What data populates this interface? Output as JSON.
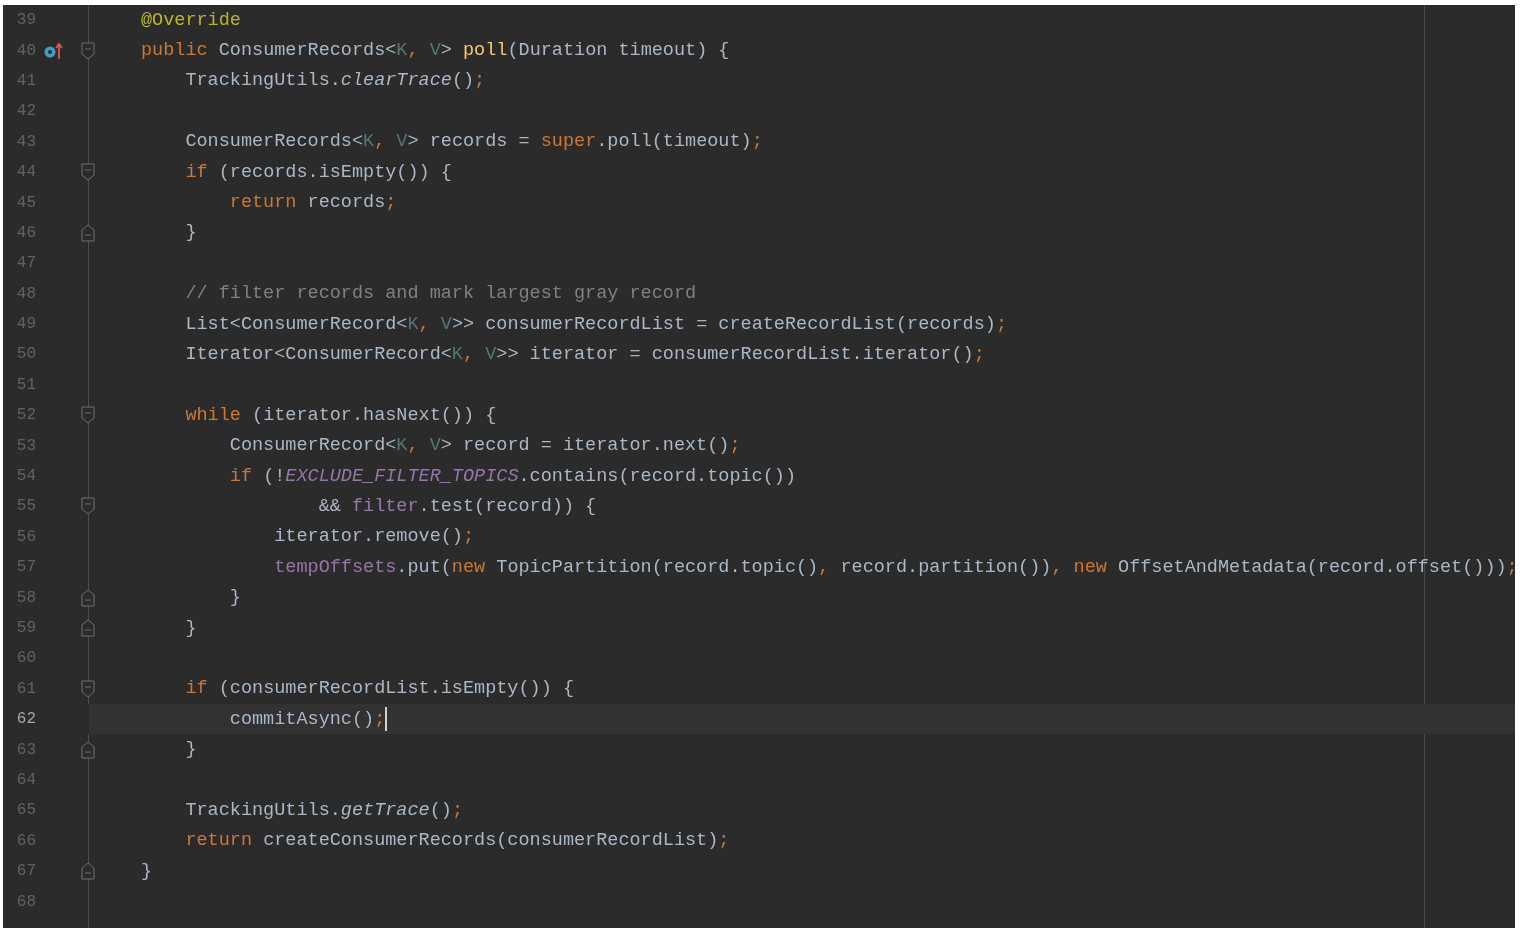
{
  "editor": {
    "lines": [
      {
        "number": "39",
        "current": false,
        "override_marker": false,
        "fold_start": false,
        "fold_end": false,
        "tokens": [
          {
            "kind": "annotation",
            "text": "@Override"
          }
        ]
      },
      {
        "number": "40",
        "current": false,
        "override_marker": true,
        "fold_start": true,
        "fold_end": false,
        "tokens": [
          {
            "kind": "keyword",
            "text": "public"
          },
          {
            "kind": "plain",
            "text": " ConsumerRecords<"
          },
          {
            "kind": "type-param",
            "text": "K"
          },
          {
            "kind": "punct",
            "text": ","
          },
          {
            "kind": "type-param",
            "text": " V"
          },
          {
            "kind": "plain",
            "text": "> "
          },
          {
            "kind": "method-decl",
            "text": "poll"
          },
          {
            "kind": "plain",
            "text": "(Duration timeout) {"
          }
        ]
      },
      {
        "number": "41",
        "current": false,
        "override_marker": false,
        "fold_start": false,
        "fold_end": false,
        "tokens": [
          {
            "kind": "plain",
            "text": "    TrackingUtils."
          },
          {
            "kind": "static-method",
            "text": "clearTrace"
          },
          {
            "kind": "plain",
            "text": "()"
          },
          {
            "kind": "punct",
            "text": ";"
          }
        ]
      },
      {
        "number": "42",
        "current": false,
        "override_marker": false,
        "fold_start": false,
        "fold_end": false
      },
      {
        "number": "43",
        "current": false,
        "override_marker": false,
        "fold_start": false,
        "fold_end": false,
        "tokens": [
          {
            "kind": "plain",
            "text": "    ConsumerRecords<"
          },
          {
            "kind": "type-param",
            "text": "K"
          },
          {
            "kind": "punct",
            "text": ","
          },
          {
            "kind": "type-param",
            "text": " V"
          },
          {
            "kind": "plain",
            "text": "> records = "
          },
          {
            "kind": "keyword",
            "text": "super"
          },
          {
            "kind": "plain",
            "text": ".poll(timeout)"
          },
          {
            "kind": "punct",
            "text": ";"
          }
        ]
      },
      {
        "number": "44",
        "current": false,
        "override_marker": false,
        "fold_start": true,
        "fold_end": false,
        "tokens": [
          {
            "kind": "keyword",
            "text": "    if"
          },
          {
            "kind": "plain",
            "text": " (records.isEmpty()) {"
          }
        ]
      },
      {
        "number": "45",
        "current": false,
        "override_marker": false,
        "fold_start": false,
        "fold_end": false,
        "tokens": [
          {
            "kind": "keyword",
            "text": "        return"
          },
          {
            "kind": "plain",
            "text": " records"
          },
          {
            "kind": "punct",
            "text": ";"
          }
        ]
      },
      {
        "number": "46",
        "current": false,
        "override_marker": false,
        "fold_start": false,
        "fold_end": true,
        "tokens": [
          {
            "kind": "plain",
            "text": "    }"
          }
        ]
      },
      {
        "number": "47",
        "current": false,
        "override_marker": false,
        "fold_start": false,
        "fold_end": false
      },
      {
        "number": "48",
        "current": false,
        "override_marker": false,
        "fold_start": false,
        "fold_end": false,
        "tokens": [
          {
            "kind": "comment",
            "text": "    // filter records and mark largest gray record"
          }
        ]
      },
      {
        "number": "49",
        "current": false,
        "override_marker": false,
        "fold_start": false,
        "fold_end": false,
        "tokens": [
          {
            "kind": "plain",
            "text": "    List<ConsumerRecord<"
          },
          {
            "kind": "type-param",
            "text": "K"
          },
          {
            "kind": "punct",
            "text": ","
          },
          {
            "kind": "type-param",
            "text": " V"
          },
          {
            "kind": "plain",
            "text": ">> consumerRecordList = createRecordList(records)"
          },
          {
            "kind": "punct",
            "text": ";"
          }
        ]
      },
      {
        "number": "50",
        "current": false,
        "override_marker": false,
        "fold_start": false,
        "fold_end": false,
        "tokens": [
          {
            "kind": "plain",
            "text": "    Iterator<ConsumerRecord<"
          },
          {
            "kind": "type-param",
            "text": "K"
          },
          {
            "kind": "punct",
            "text": ","
          },
          {
            "kind": "type-param",
            "text": " V"
          },
          {
            "kind": "plain",
            "text": ">> iterator = consumerRecordList.iterator()"
          },
          {
            "kind": "punct",
            "text": ";"
          }
        ]
      },
      {
        "number": "51",
        "current": false,
        "override_marker": false,
        "fold_start": false,
        "fold_end": false
      },
      {
        "number": "52",
        "current": false,
        "override_marker": false,
        "fold_start": true,
        "fold_end": false,
        "tokens": [
          {
            "kind": "keyword",
            "text": "    while"
          },
          {
            "kind": "plain",
            "text": " (iterator.hasNext()) {"
          }
        ]
      },
      {
        "number": "53",
        "current": false,
        "override_marker": false,
        "fold_start": false,
        "fold_end": false,
        "tokens": [
          {
            "kind": "plain",
            "text": "        ConsumerRecord<"
          },
          {
            "kind": "type-param",
            "text": "K"
          },
          {
            "kind": "punct",
            "text": ","
          },
          {
            "kind": "type-param",
            "text": " V"
          },
          {
            "kind": "plain",
            "text": "> record = iterator.next()"
          },
          {
            "kind": "punct",
            "text": ";"
          }
        ]
      },
      {
        "number": "54",
        "current": false,
        "override_marker": false,
        "fold_start": false,
        "fold_end": false,
        "tokens": [
          {
            "kind": "keyword",
            "text": "        if"
          },
          {
            "kind": "plain",
            "text": " (!"
          },
          {
            "kind": "static-field",
            "text": "EXCLUDE_FILTER_TOPICS"
          },
          {
            "kind": "plain",
            "text": ".contains(record.topic())"
          }
        ]
      },
      {
        "number": "55",
        "current": false,
        "override_marker": false,
        "fold_start": true,
        "fold_end": false,
        "tokens": [
          {
            "kind": "plain",
            "text": "                && "
          },
          {
            "kind": "field",
            "text": "filter"
          },
          {
            "kind": "plain",
            "text": ".test(record)) {"
          }
        ]
      },
      {
        "number": "56",
        "current": false,
        "override_marker": false,
        "fold_start": false,
        "fold_end": false,
        "tokens": [
          {
            "kind": "plain",
            "text": "            iterator.remove()"
          },
          {
            "kind": "punct",
            "text": ";"
          }
        ]
      },
      {
        "number": "57",
        "current": false,
        "override_marker": false,
        "fold_start": false,
        "fold_end": false,
        "tokens": [
          {
            "kind": "field",
            "text": "            tempOffsets"
          },
          {
            "kind": "plain",
            "text": ".put("
          },
          {
            "kind": "keyword",
            "text": "new"
          },
          {
            "kind": "plain",
            "text": " TopicPartition(record.topic()"
          },
          {
            "kind": "punct",
            "text": ","
          },
          {
            "kind": "plain",
            "text": " record.partition())"
          },
          {
            "kind": "punct",
            "text": ","
          },
          {
            "kind": "keyword",
            "text": " new"
          },
          {
            "kind": "plain",
            "text": " OffsetAndMetadata(record.offset()))"
          },
          {
            "kind": "punct",
            "text": ";"
          }
        ]
      },
      {
        "number": "58",
        "current": false,
        "override_marker": false,
        "fold_start": false,
        "fold_end": true,
        "tokens": [
          {
            "kind": "plain",
            "text": "        }"
          }
        ]
      },
      {
        "number": "59",
        "current": false,
        "override_marker": false,
        "fold_start": false,
        "fold_end": true,
        "tokens": [
          {
            "kind": "plain",
            "text": "    }"
          }
        ]
      },
      {
        "number": "60",
        "current": false,
        "override_marker": false,
        "fold_start": false,
        "fold_end": false
      },
      {
        "number": "61",
        "current": false,
        "override_marker": false,
        "fold_start": true,
        "fold_end": false,
        "tokens": [
          {
            "kind": "keyword",
            "text": "    if"
          },
          {
            "kind": "plain",
            "text": " (consumerRecordList.isEmpty()) {"
          }
        ]
      },
      {
        "number": "62",
        "current": true,
        "override_marker": false,
        "fold_start": false,
        "fold_end": false,
        "tokens": [
          {
            "kind": "plain",
            "text": "        commitAsync()"
          },
          {
            "kind": "punct",
            "text": ";"
          }
        ]
      },
      {
        "number": "63",
        "current": false,
        "override_marker": false,
        "fold_start": false,
        "fold_end": true,
        "tokens": [
          {
            "kind": "plain",
            "text": "    }"
          }
        ]
      },
      {
        "number": "64",
        "current": false,
        "override_marker": false,
        "fold_start": false,
        "fold_end": false
      },
      {
        "number": "65",
        "current": false,
        "override_marker": false,
        "fold_start": false,
        "fold_end": false,
        "tokens": [
          {
            "kind": "plain",
            "text": "    TrackingUtils."
          },
          {
            "kind": "static-method",
            "text": "getTrace"
          },
          {
            "kind": "plain",
            "text": "()"
          },
          {
            "kind": "punct",
            "text": ";"
          }
        ]
      },
      {
        "number": "66",
        "current": false,
        "override_marker": false,
        "fold_start": false,
        "fold_end": false,
        "tokens": [
          {
            "kind": "keyword",
            "text": "    return"
          },
          {
            "kind": "plain",
            "text": " createConsumerRecords(consumerRecordList)"
          },
          {
            "kind": "punct",
            "text": ";"
          }
        ]
      },
      {
        "number": "67",
        "current": false,
        "override_marker": false,
        "fold_start": false,
        "fold_end": true,
        "tokens": [
          {
            "kind": "plain",
            "text": "}"
          }
        ]
      },
      {
        "number": "68",
        "current": false,
        "override_marker": false,
        "fold_start": false,
        "fold_end": false
      }
    ]
  }
}
